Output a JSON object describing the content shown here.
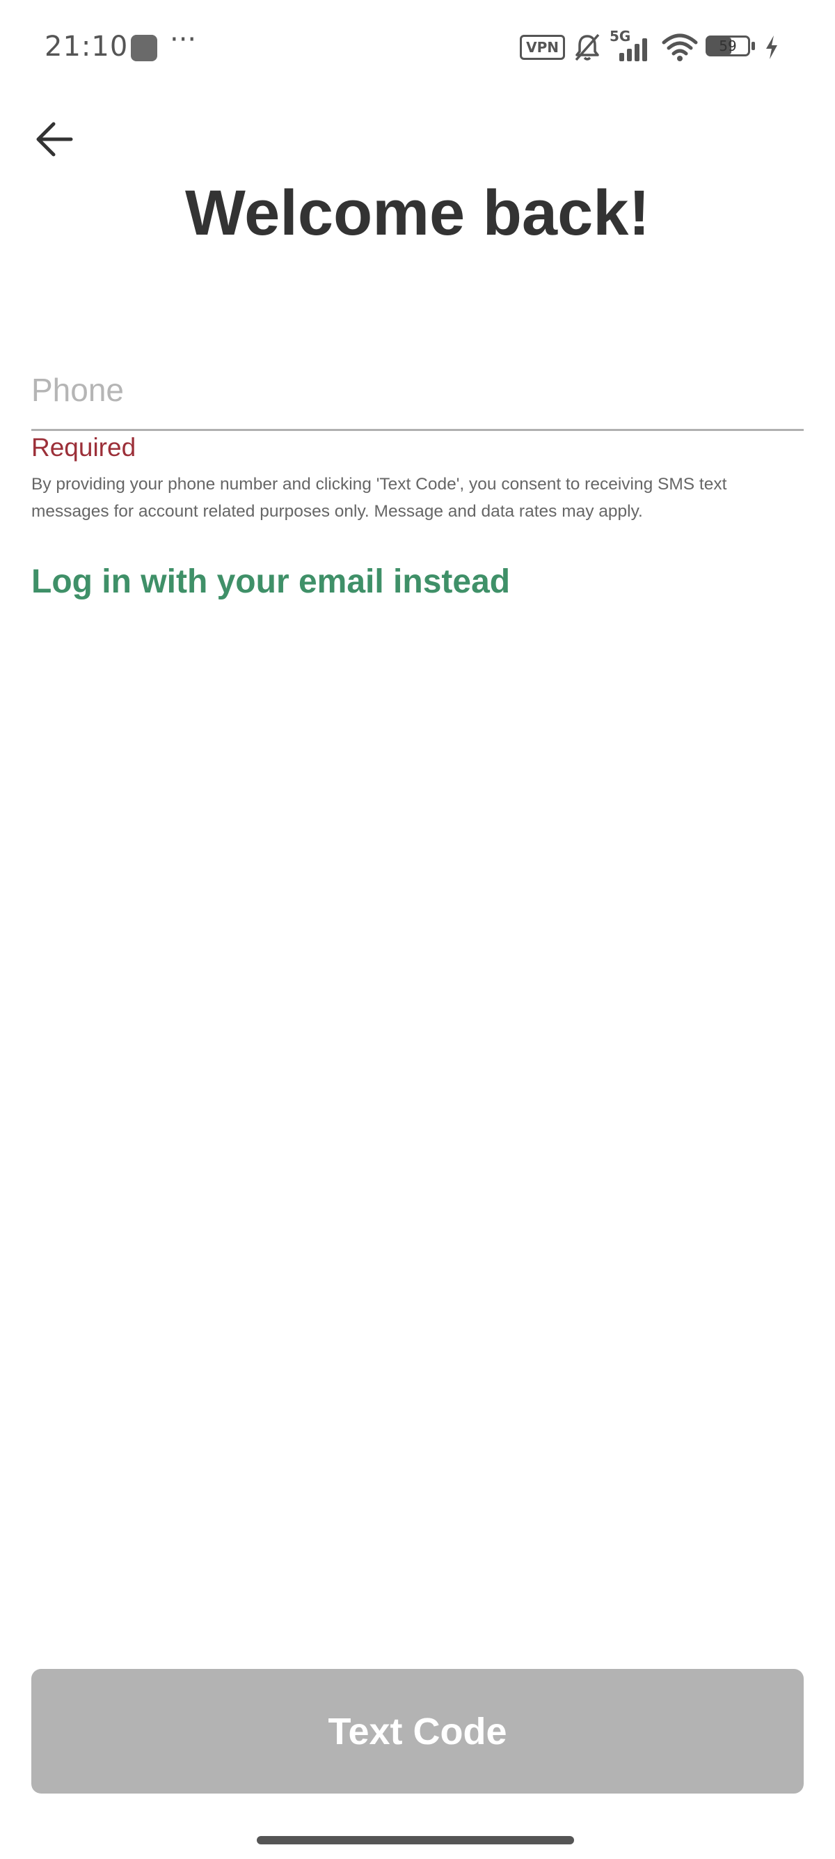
{
  "status_bar": {
    "time": "21:10",
    "more_indicator": "···",
    "vpn_label": "VPN",
    "network_label": "5G",
    "battery_level": 59,
    "battery_text": "59",
    "icons": [
      "app-notification-icon",
      "vpn-icon",
      "bell-muted-icon",
      "signal-icon",
      "wifi-icon",
      "battery-icon",
      "charging-icon"
    ]
  },
  "header": {
    "back_icon": "arrow-left-icon",
    "title": "Welcome back!"
  },
  "form": {
    "phone": {
      "placeholder": "Phone",
      "value": ""
    },
    "error": "Required",
    "consent": "By providing your phone number and clicking 'Text Code', you consent to receiving SMS text messages for account related purposes only. Message and data rates may apply.",
    "email_link": "Log in with your email instead"
  },
  "footer": {
    "submit_label": "Text Code"
  },
  "colors": {
    "title": "#333333",
    "error": "#9c3039",
    "link": "#3f9068",
    "button_disabled": "#b3b3b3",
    "placeholder": "#b5b5b5"
  }
}
